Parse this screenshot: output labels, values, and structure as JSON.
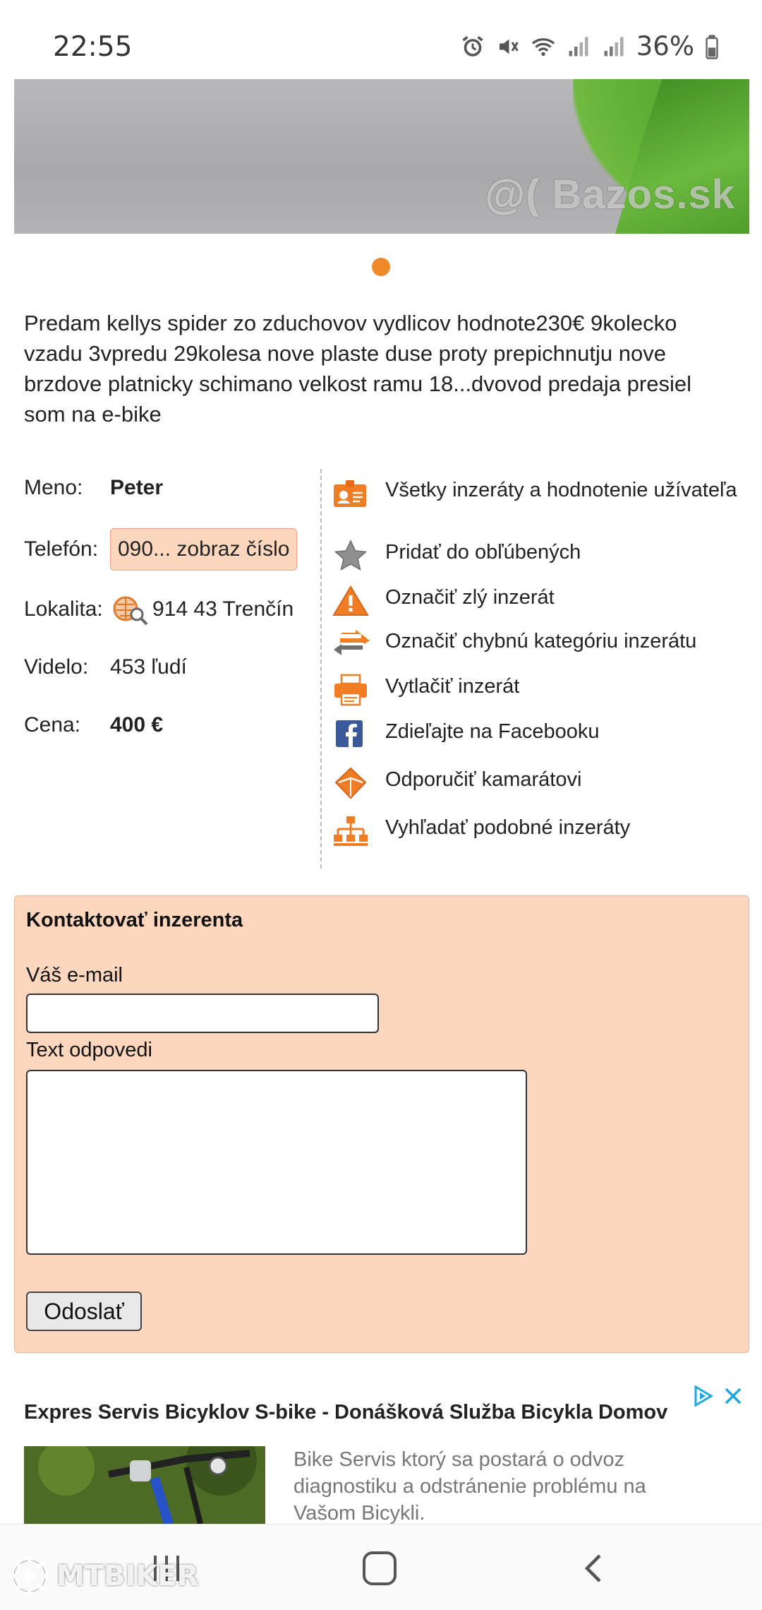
{
  "status_bar": {
    "time": "22:55",
    "battery": "36%",
    "icons": [
      "alarm-icon",
      "mute-icon",
      "wifi-icon",
      "signal-icon",
      "signal-icon",
      "battery-icon"
    ]
  },
  "listing": {
    "image_watermark": "@( Bazos.sk",
    "description": "Predam kellys spider zo zduchovov vydlicov hodnote230€ 9kolecko vzadu 3vpredu 29kolesa nove plaste duse proty prepichnutju nove brzdove platnicky schimano velkost ramu 18...dvovod predaja presiel som na e-bike"
  },
  "details": {
    "name_label": "Meno:",
    "name_value": "Peter",
    "phone_label": "Telefón:",
    "phone_value": "090... zobraz číslo",
    "location_label": "Lokalita:",
    "location_value": "914 43 Trenčín",
    "views_label": "Videlo:",
    "views_value": "453 ľudí",
    "price_label": "Cena:",
    "price_value": "400 €"
  },
  "actions": [
    {
      "label": "Všetky inzeráty a hodnotenie užívateľa",
      "icon": "user-card-icon"
    },
    {
      "label": "Pridať do obľúbených",
      "icon": "star-icon"
    },
    {
      "label": "Označiť zlý inzerát",
      "icon": "warning-icon"
    },
    {
      "label": "Označiť chybnú kategóriu inzerátu",
      "icon": "swap-arrows-icon"
    },
    {
      "label": "Vytlačiť inzerát",
      "icon": "printer-icon"
    },
    {
      "label": "Zdieľajte na Facebooku",
      "icon": "facebook-icon"
    },
    {
      "label": "Odporučiť kamarátovi",
      "icon": "envelope-icon"
    },
    {
      "label": "Vyhľadať podobné inzeráty",
      "icon": "sitemap-icon"
    }
  ],
  "contact_form": {
    "title": "Kontaktovať inzerenta",
    "email_label": "Váš e-mail",
    "email_value": "",
    "text_label": "Text odpovedi",
    "text_value": "",
    "submit_label": "Odoslať"
  },
  "ad": {
    "title": "Expres Servis Bicyklov S-bike - Donášková Služba Bicykla Domov",
    "text": "Bike Servis ktorý sa postará o odvoz diagnostiku a odstránenie problému na Vašom Bicykli."
  },
  "overlay_watermark": "MTBIKER",
  "colors": {
    "accent_orange": "#f0892a",
    "form_background": "#fdd7bd",
    "ad_choices_blue": "#1ea7e1"
  }
}
